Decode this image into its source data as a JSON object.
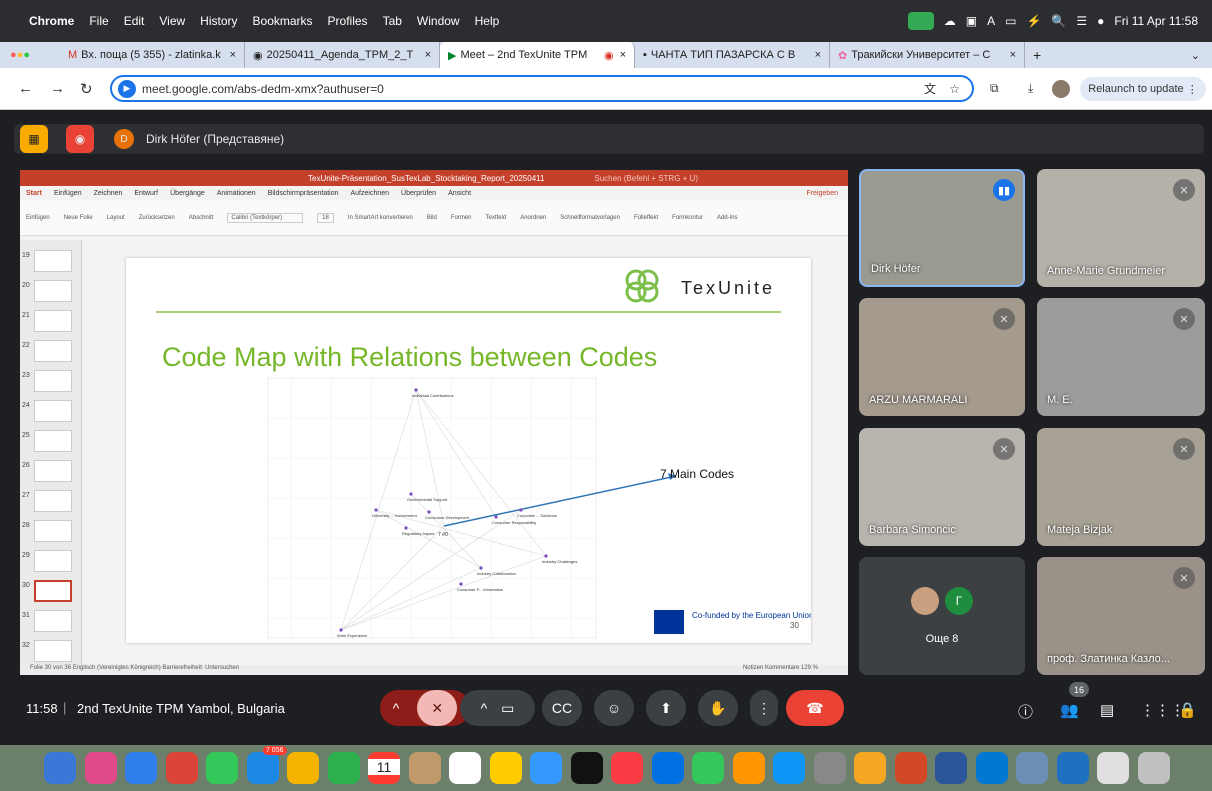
{
  "menubar": {
    "app": "Chrome",
    "items": [
      "File",
      "Edit",
      "View",
      "History",
      "Bookmarks",
      "Profiles",
      "Tab",
      "Window",
      "Help"
    ],
    "clock": "Fri 11 Apr  11:58"
  },
  "tabs": [
    {
      "label": "Вх. поща (5 355) - zlatinka.k"
    },
    {
      "label": "20250411_Agenda_TPM_2_T"
    },
    {
      "label": "Meet – 2nd TexUnite TPM"
    },
    {
      "label": "ЧАНТА ТИП ПАЗАРСКА С В"
    },
    {
      "label": "Тракийски Университет – С"
    }
  ],
  "address": {
    "url": "meet.google.com/abs-dedm-xmx?authuser=0",
    "relaunch": "Relaunch to update"
  },
  "presenter": {
    "initial": "D",
    "text": "Dirk Höfer (Представяне)"
  },
  "ppt": {
    "title": "TexUnite-Präsentation_SusTexLab_Stocktaking_Report_20250411",
    "search": "Suchen (Befehl + STRG + U)",
    "share": "Freigeben",
    "tabs": [
      "Start",
      "Einfügen",
      "Zeichnen",
      "Entwurf",
      "Übergänge",
      "Animationen",
      "Bildschirmpräsentation",
      "Aufzeichnen",
      "Überprüfen",
      "Ansicht"
    ],
    "ribbon": [
      "Einfügen",
      "Neue Folie",
      "Layout",
      "Zurücksetzen",
      "Abschnitt",
      "Calibri (Textkörper)",
      "18",
      "In SmartArt konvertieren",
      "Bild",
      "Formen",
      "Textfeld",
      "Anordnen",
      "Schnellformatvorlagen",
      "Fülleffekt",
      "Formkontur",
      "Add-Ins"
    ],
    "slide_numbers": [
      "19",
      "20",
      "21",
      "22",
      "23",
      "24",
      "25",
      "26",
      "27",
      "28",
      "29",
      "30",
      "31",
      "32"
    ],
    "status": {
      "left": "Folie 30 von 36   Englisch (Vereinigtes Königreich)   Barrierefreiheit: Untersuchen",
      "right": "Notizen   Kommentare       129 %"
    },
    "slide": {
      "brand": "TexUnite",
      "title": "Code Map with Relations between Codes",
      "annotation": "7 Main Codes",
      "eu": "Co-funded by\nthe European Union",
      "page": "30",
      "nodes": [
        "Individual Contributions",
        "Governmental Support",
        "University ... Involvement",
        "Curriculum Development",
        "Regulatory Impact",
        "Corporate ... Solutions",
        "Consumer Responsibility",
        "Industry Challenges",
        "Industry Collaboration",
        "Consumer P... Information",
        "Work Experience"
      ],
      "center": "7 #0"
    }
  },
  "participants": [
    {
      "name": "Dirk Höfer"
    },
    {
      "name": "Anne-Marie Grundmeier"
    },
    {
      "name": "ARZU MARMARALI"
    },
    {
      "name": "M. E."
    },
    {
      "name": "Barbara Simoncic"
    },
    {
      "name": "Mateja Bizjak"
    },
    {
      "name": "Още 8"
    },
    {
      "name": "проф. Златинка Казло..."
    }
  ],
  "bottom": {
    "time": "11:58",
    "meeting": "2nd TexUnite TPM Yambol, Bulgaria",
    "participant_count": "16"
  },
  "dock": {
    "calendar_month": "APR",
    "calendar_day": "11",
    "mail_badge": "7 056"
  }
}
